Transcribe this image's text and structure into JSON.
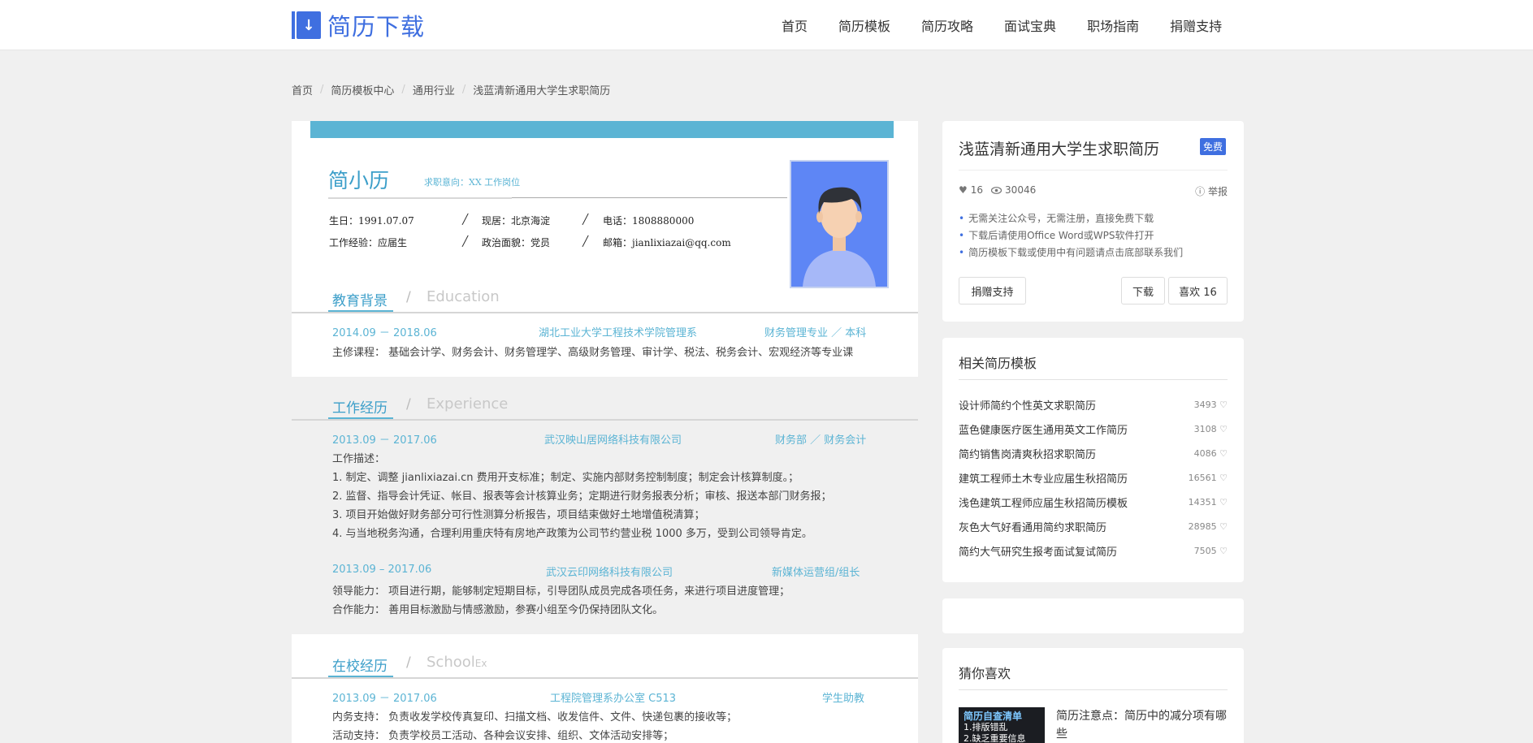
{
  "header": {
    "logo_text": "简历下载",
    "nav": [
      "首页",
      "简历模板",
      "简历攻略",
      "面试宝典",
      "职场指南",
      "捐赠支持"
    ]
  },
  "breadcrumb": [
    "首页",
    "简历模板中心",
    "通用行业",
    "浅蓝清新通用大学生求职简历"
  ],
  "resume": {
    "name": "简小历",
    "intent": "求职意向：XX 工作岗位",
    "info": {
      "birth": "生日：1991.07.07",
      "location": "现居：北京海淀",
      "phone": "电话：1808880000",
      "experience": "工作经验：应届生",
      "politics": "政治面貌：党员",
      "email": "邮箱：jianlixiazai@qq.com",
      "slash": "╱"
    },
    "education": {
      "title": "教育背景",
      "sep": "/",
      "en": "Education",
      "date": "2014.09 － 2018.06",
      "school": "湖北工业大学工程技术学院管理系",
      "major": "财务管理专业 ／ 本科",
      "courses": "主修课程：  基础会计学、财务会计、财务管理学、高级财务管理、审计学、税法、税务会计、宏观经济等专业课"
    },
    "work": {
      "title": "工作经历",
      "sep": "/",
      "en": "Experience",
      "job1": {
        "date": "2013.09 － 2017.06",
        "company": "武汉映山居网络科技有限公司",
        "role": "财务部 ／ 财务会计",
        "desc_label": "工作描述：",
        "items": [
          "1.  制定、调整 jianlixiazai.cn 费用开支标准；制定、实施内部财务控制制度；制定会计核算制度。；",
          "2.  监督、指导会计凭证、帐目、报表等会计核算业务；定期进行财务报表分析；审核、报送本部门财务报；",
          "3.  项目开始做好财务部分可行性测算分析报告，项目结束做好土地增值税清算；",
          "4.  与当地税务沟通，合理利用重庆特有房地产政策为公司节约营业税 1000 多万，受到公司领导肯定。"
        ]
      },
      "job2": {
        "date": "2013.09 – 2017.06",
        "company": "武汉云印网络科技有限公司",
        "role": "新媒体运营组/组长",
        "items": [
          "领导能力：    项目进行期，能够制定短期目标，引导团队成员完成各项任务，来进行项目进度管理；",
          "合作能力：    善用目标激励与情感激励，参赛小组至今仍保持团队文化。"
        ]
      }
    },
    "school": {
      "title": "在校经历",
      "sep": "/",
      "en": "School",
      "en_sub": "Ex",
      "date": "2013.09 － 2017.06",
      "place": "工程院管理系办公室 C513",
      "role": "学生助教",
      "items": [
        "内务支持：    负责收发学校传真复印、扫描文档、收发信件、文件、快递包裹的接收等；",
        "活动支持：    负责学校员工活动、各种会议安排、组织、文体活动安排等；"
      ]
    }
  },
  "detail": {
    "title": "浅蓝清新通用大学生求职简历",
    "badge": "免费",
    "likes": "16",
    "views": "30046",
    "report": "举报",
    "notes": [
      "无需关注公众号，无需注册，直接免费下载",
      "下载后请使用Office Word或WPS软件打开",
      "简历模板下载或使用中有问题请点击底部联系我们"
    ],
    "donate_label": "捐赠支持",
    "download_label": "下载",
    "like_label": "喜欢 16"
  },
  "related": {
    "title": "相关简历模板",
    "items": [
      {
        "title": "设计师简约个性英文求职简历",
        "count": "3493"
      },
      {
        "title": "蓝色健康医疗医生通用英文工作简历",
        "count": "3108"
      },
      {
        "title": "简约销售岗清爽秋招求职简历",
        "count": "4086"
      },
      {
        "title": "建筑工程师土木专业应届生秋招简历",
        "count": "16561"
      },
      {
        "title": "浅色建筑工程师应届生秋招简历模板",
        "count": "14351"
      },
      {
        "title": "灰色大气好看通用简约求职简历",
        "count": "28985"
      },
      {
        "title": "简约大气研究生报考面试复试简历",
        "count": "7505"
      }
    ]
  },
  "guess": {
    "title": "猜你喜欢",
    "thumb_title": "简历自查清单",
    "thumb_line1": "1.排版错乱",
    "thumb_line2": "2.缺乏重要信息",
    "article": "简历注意点：简历中的减分项有哪些"
  },
  "colors": {
    "accent": "#3f6fe0",
    "resume_blue": "#5bb4d4"
  }
}
